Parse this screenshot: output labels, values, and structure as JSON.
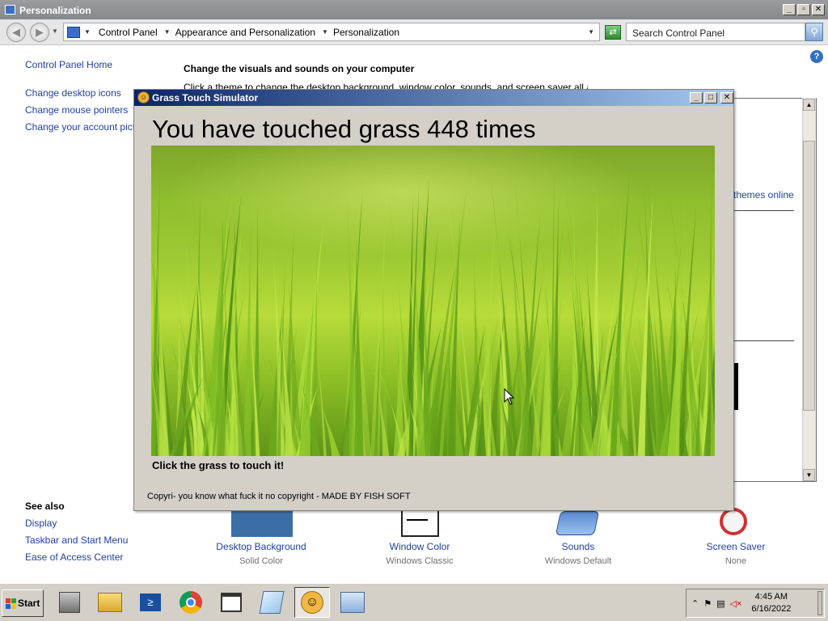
{
  "window": {
    "title": "Personalization",
    "controls": [
      "_",
      "▫",
      "✕"
    ]
  },
  "nav": {
    "back": "◀",
    "forward": "▶",
    "breadcrumbs": [
      "Control Panel",
      "Appearance and Personalization",
      "Personalization"
    ],
    "search_placeholder": "Search Control Panel",
    "help": "?"
  },
  "sidebar": {
    "home": "Control Panel Home",
    "links": [
      "Change desktop icons",
      "Change mouse pointers",
      "Change your account pictur"
    ],
    "see_also_heading": "See also",
    "see_also": [
      "Display",
      "Taskbar and Start Menu",
      "Ease of Access Center"
    ]
  },
  "main": {
    "heading": "Change the visuals and sounds on your computer",
    "subheading": "Click a theme to change the desktop background, window color, sounds, and screen saver all at once.",
    "themes_online": "themes online",
    "tiles": [
      {
        "name": "Desktop Background",
        "value": "Solid Color"
      },
      {
        "name": "Window Color",
        "value": "Windows Classic"
      },
      {
        "name": "Sounds",
        "value": "Windows Default"
      },
      {
        "name": "Screen Saver",
        "value": "None"
      }
    ]
  },
  "popup": {
    "title": "Grass Touch Simulator",
    "counter_text": "You have touched grass 448 times",
    "hint": "Click the grass to touch it!",
    "footer": "Copyri- you know what fuck it no copyright - MADE BY FISH SOFT",
    "controls": [
      "_",
      "□",
      "✕"
    ]
  },
  "taskbar": {
    "start_label": "Start",
    "apps": [
      "server-manager-icon",
      "file-explorer-icon",
      "powershell-icon",
      "chrome-icon",
      "window-icon",
      "notepad-icon",
      "grass-touch-simulator-icon",
      "control-panel-icon"
    ],
    "active_app": "grass-touch-simulator-icon",
    "time": "4:45 AM",
    "date": "6/16/2022"
  },
  "colors": {
    "link": "#1f3fa8",
    "classic_face": "#d4d0c8",
    "titlebar_active": "#0a246a",
    "grass": "#8fbe2e"
  }
}
